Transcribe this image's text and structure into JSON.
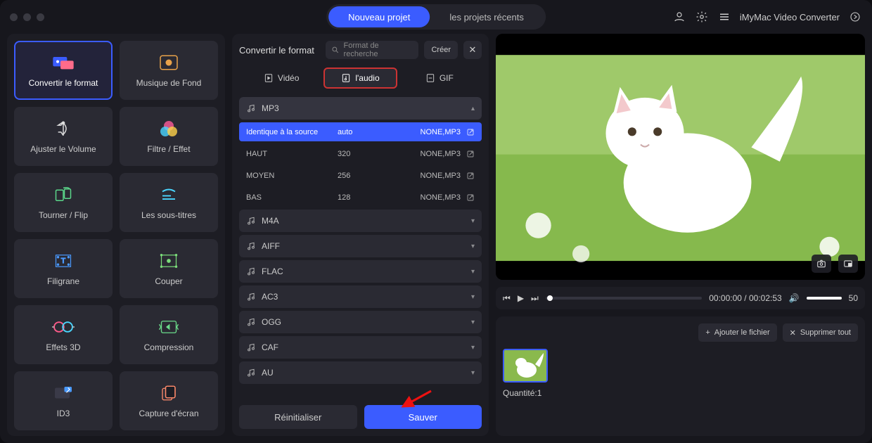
{
  "titlebar": {
    "tab_new": "Nouveau projet",
    "tab_recent": "les projets récents",
    "app_name": "iMyMac Video Converter"
  },
  "tools": [
    {
      "name": "convert-format",
      "label": "Convertir le format",
      "active": true
    },
    {
      "name": "background-music",
      "label": "Musique de Fond"
    },
    {
      "name": "adjust-volume",
      "label": "Ajuster le Volume"
    },
    {
      "name": "filter-effect",
      "label": "Filtre / Effet"
    },
    {
      "name": "rotate-flip",
      "label": "Tourner / Flip"
    },
    {
      "name": "subtitles",
      "label": "Les sous-titres"
    },
    {
      "name": "watermark",
      "label": "Filigrane"
    },
    {
      "name": "crop",
      "label": "Couper"
    },
    {
      "name": "effects-3d",
      "label": "Effets 3D"
    },
    {
      "name": "compression",
      "label": "Compression"
    },
    {
      "name": "id3",
      "label": "ID3"
    },
    {
      "name": "screenshot",
      "label": "Capture d'écran"
    }
  ],
  "mid": {
    "title": "Convertir le format",
    "search_placeholder": "Format de recherche",
    "create": "Créer",
    "tabs": {
      "video": "Vidéo",
      "audio": "l'audio",
      "gif": "GIF"
    },
    "expanded": "MP3",
    "presets": [
      {
        "name": "Identique à la source",
        "bitrate": "auto",
        "codec": "NONE,MP3",
        "selected": true
      },
      {
        "name": "HAUT",
        "bitrate": "320",
        "codec": "NONE,MP3"
      },
      {
        "name": "MOYEN",
        "bitrate": "256",
        "codec": "NONE,MP3"
      },
      {
        "name": "BAS",
        "bitrate": "128",
        "codec": "NONE,MP3"
      }
    ],
    "formats": [
      "M4A",
      "AIFF",
      "FLAC",
      "AC3",
      "OGG",
      "CAF",
      "AU"
    ],
    "reset": "Réinitialiser",
    "save": "Sauver"
  },
  "player": {
    "time_current": "00:00:00",
    "time_total": "00:02:53",
    "volume": "50"
  },
  "queue": {
    "add_file": "Ajouter le fichier",
    "remove_all": "Supprimer tout",
    "quantity_label": "Quantité:",
    "quantity_value": "1"
  },
  "colors": {
    "accent": "#3b5cff",
    "highlight": "#c33"
  }
}
